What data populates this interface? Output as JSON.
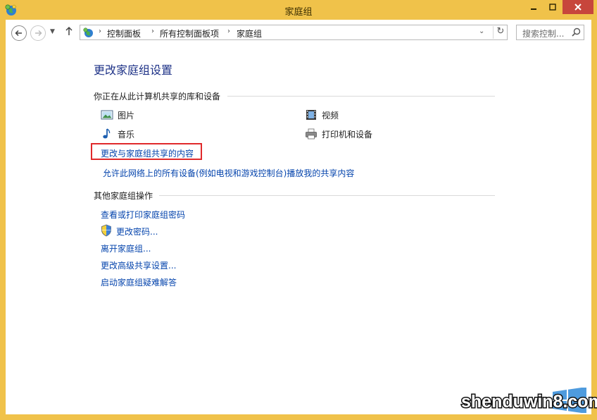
{
  "window": {
    "title": "家庭组"
  },
  "address": {
    "crumbs": [
      "控制面板",
      "所有控制面板项",
      "家庭组"
    ]
  },
  "search": {
    "placeholder": "搜索控制..."
  },
  "main": {
    "heading": "更改家庭组设置",
    "shared_section": {
      "title": "你正在从此计算机共享的库和设备",
      "items": [
        {
          "label": "图片",
          "icon": "pictures-icon"
        },
        {
          "label": "视频",
          "icon": "video-icon"
        },
        {
          "label": "音乐",
          "icon": "music-icon"
        },
        {
          "label": "打印机和设备",
          "icon": "printer-icon"
        }
      ],
      "link_change_shared": "更改与家庭组共享的内容",
      "link_allow_devices": "允许此网络上的所有设备(例如电视和游戏控制台)播放我的共享内容"
    },
    "other_section": {
      "title": "其他家庭组操作",
      "links": [
        "查看或打印家庭组密码",
        "更改密码...",
        "离开家庭组...",
        "更改高级共享设置...",
        "启动家庭组疑难解答"
      ]
    }
  },
  "watermark": {
    "text": "shenduwin8.com"
  },
  "colors": {
    "titlebar": "#f0c24a",
    "link": "#0645ad",
    "heading": "#1e3287",
    "highlight": "#e0292b"
  }
}
